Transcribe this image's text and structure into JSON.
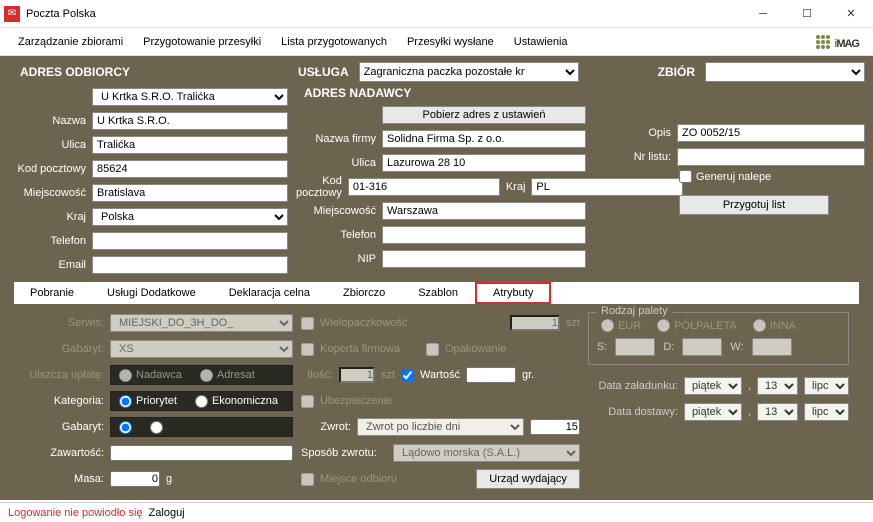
{
  "window": {
    "title": "Poczta Polska"
  },
  "menu": {
    "zarzadzanie": "Zarządzanie zbiorami",
    "przygotowanie": "Przygotowanie przesyłki",
    "lista": "Lista przygotowanych",
    "wyslane": "Przesyłki wysłane",
    "ustawienia": "Ustawienia"
  },
  "logo": {
    "i": "i",
    "mag": "MAG"
  },
  "sections": {
    "odbiorcy": "ADRES ODBIORCY",
    "usluga": "USŁUGA",
    "nadawcy": "ADRES NADAWCY",
    "zbior": "ZBIÓR"
  },
  "usluga": {
    "selected": "Zagraniczna paczka pozostałe kr"
  },
  "zbior": {
    "selected": ""
  },
  "odbiorca": {
    "lookup_selected": "U Krtka S.R.O. Tralićka",
    "labels": {
      "nazwa": "Nazwa",
      "ulica": "Ulica",
      "kod": "Kod pocztowy",
      "miejscowosc": "Miejscowość",
      "kraj": "Kraj",
      "telefon": "Telefon",
      "email": "Email"
    },
    "nazwa": "U Krtka S.R.O.",
    "ulica": "Tralićka",
    "kod": "85624",
    "miejscowosc": "Bratislava",
    "kraj": "Polska",
    "telefon": "",
    "email": ""
  },
  "nadawca": {
    "pobierz_btn": "Pobierz adres z ustawień",
    "labels": {
      "firma": "Nazwa firmy",
      "ulica": "Ulica",
      "kod": "Kod pocztowy",
      "kraj": "Kraj",
      "miejscowosc": "Miejscowość",
      "telefon": "Telefon",
      "nip": "NIP"
    },
    "firma": "Solidna Firma Sp. z o.o.",
    "ulica": "Lazurowa 28 10",
    "kod": "01-316",
    "kraj": "PL",
    "miejscowosc": "Warszawa",
    "telefon": "",
    "nip": ""
  },
  "zbiorpanel": {
    "labels": {
      "opis": "Opis",
      "nrlistu": "Nr listu:",
      "generuj": "Generuj nalepe",
      "przygotuj": "Przygotuj list"
    },
    "opis": "ZO 0052/15",
    "nrlistu": ""
  },
  "tabs": {
    "pobranie": "Pobranie",
    "uslugi": "Usługi Dodatkowe",
    "deklaracja": "Deklaracja celna",
    "zbiorczo": "Zbiorczo",
    "szablon": "Szablon",
    "atrybuty": "Atrybuty"
  },
  "attrib": {
    "labels": {
      "serwis": "Serwis:",
      "gabaryt": "Gabaryt:",
      "uiszcza": "Uiszcza upłatę:",
      "kategoria": "Kategoria:",
      "gabaryt2": "Gabaryt:",
      "zawartosc": "Zawartość:",
      "masa": "Masa:",
      "wielo": "Wielopaczkowość",
      "koperta": "Koperta firmowa",
      "opakowanie": "Opakowanie",
      "ilosc": "Ilość:",
      "wartosc": "Wartość",
      "ubezp": "Ubezpieczenie",
      "zwrot": "Zwrot:",
      "sposob": "Sposób zwrotu:",
      "miejsce": "Miejsce odbioru",
      "urzad": "Urząd wydający",
      "rodzaj": "Rodzaj palety",
      "zaladunek": "Data załadunku:",
      "dostawa": "Data dostawy:"
    },
    "serwis": "MIEJSKI_DO_3H_DO_",
    "gabaryt": "XS",
    "nadawca": "Nadawca",
    "adresat": "Adresat",
    "priorytet": "Priorytet",
    "ekonomiczna": "Ekonomiczna",
    "masa": "0",
    "masa_unit": "g",
    "wielo_val": "1",
    "wielo_unit": "szt",
    "ilosc_val": "1",
    "ilosc_unit": "szt",
    "wartosc_unit": "gr.",
    "zwrot_sel": "Zwrot po liczbie dni",
    "zwrot_days": "15",
    "sposob_sel": "Lądowo morska (S.A.L.)",
    "palette": {
      "eur": "EUR",
      "pol": "PÓŁPALETA",
      "inna": "INNA",
      "s": "S:",
      "d": "D:",
      "w": "W:"
    },
    "date": {
      "day": "piątek",
      "num": "13",
      "month": "lipc"
    }
  },
  "status": {
    "error": "Logowanie nie powiodło się",
    "login": "Zaloguj"
  }
}
